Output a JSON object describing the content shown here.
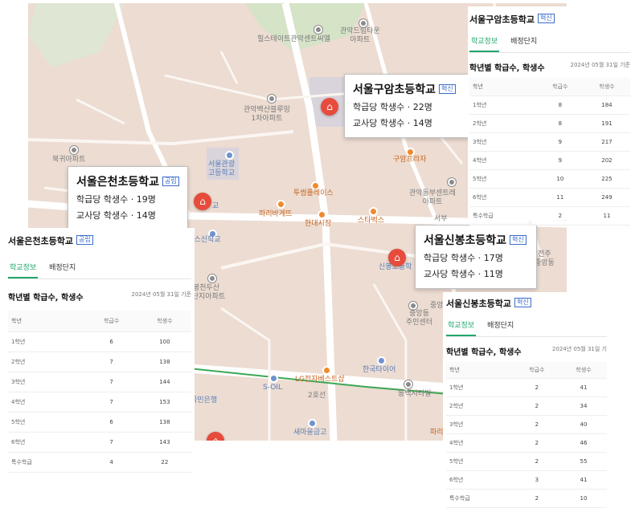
{
  "map": {
    "pois": [
      {
        "id": "hillstate",
        "label": "힐스테이트관악센트씨엘",
        "style": "gray"
      },
      {
        "id": "dreamtown",
        "label": "관악드림타운\n아파트",
        "style": "gray"
      },
      {
        "id": "byeoksan",
        "label": "관악벽산블루밍\n1차아파트",
        "style": "gray"
      },
      {
        "id": "bukgeo",
        "label": "북귀아파트",
        "style": "gray"
      },
      {
        "id": "gwanak_high",
        "label": "서울관광\n고등학교",
        "style": "blue"
      },
      {
        "id": "touples",
        "label": "투썸플레이스",
        "style": "orange"
      },
      {
        "id": "paris",
        "label": "파리바게뜨",
        "style": "orange"
      },
      {
        "id": "hyundai",
        "label": "현대시장",
        "style": "orange"
      },
      {
        "id": "starbucks",
        "label": "스타벅스",
        "style": "orange"
      },
      {
        "id": "guam_plaza",
        "label": "구암프라자",
        "style": "orange"
      },
      {
        "id": "gwanak_central",
        "label": "관악동부센트레\n아파트",
        "style": "gray"
      },
      {
        "id": "balsan",
        "label": "발산스신학교",
        "style": "blue"
      },
      {
        "id": "bongcheon",
        "label": "봉천두산\n1단지아파트",
        "style": "gray"
      },
      {
        "id": "jungang",
        "label": "중앙동\n주민센터",
        "style": "gray"
      },
      {
        "id": "jeonju",
        "label": "전주\n중앙동",
        "style": "gray"
      },
      {
        "id": "hankook",
        "label": "한국타이어",
        "style": "blue"
      },
      {
        "id": "dongbaek",
        "label": "동백시티빌",
        "style": "gray"
      },
      {
        "id": "lg",
        "label": "LG전자베스트샵",
        "style": "orange"
      },
      {
        "id": "soil",
        "label": "S-OIL",
        "style": "blue"
      },
      {
        "id": "kookmin",
        "label": "국민은행",
        "style": "blue"
      },
      {
        "id": "saemaeul",
        "label": "새마을금고",
        "style": "blue"
      },
      {
        "id": "line2",
        "label": "2호선",
        "style": "gray"
      },
      {
        "id": "shinbong_map",
        "label": "신봉초등학",
        "style": "blue"
      },
      {
        "id": "eunchun_map",
        "label": "교",
        "style": "blue"
      },
      {
        "id": "parisb",
        "label": "파리",
        "style": "orange"
      },
      {
        "id": "jungang_b",
        "label": "중앙",
        "style": "gray"
      },
      {
        "id": "seobuk",
        "label": "서부",
        "style": "gray"
      }
    ],
    "bubbles": {
      "guam": {
        "name": "서울구암초등학교",
        "badge": "혁신",
        "line1": "학급당 학생수 · 22명",
        "line2": "교사당 학생수 · 14명"
      },
      "eunchun": {
        "name": "서울은천초등학교",
        "badge": "공립",
        "line1": "학급당 학생수 · 19명",
        "line2": "교사당 학생수 · 14명"
      },
      "shinbong": {
        "name": "서울신봉초등학교",
        "badge": "혁신",
        "line1": "학급당 학생수 · 17명",
        "line2": "교사당 학생수 · 11명"
      }
    }
  },
  "panels": {
    "guam": {
      "name": "서울구암초등학교",
      "badge": "혁신",
      "tabs": [
        "학교정보",
        "배정단지"
      ],
      "section": "학년별 학급수, 학생수",
      "date": "2024년 05월 31일 기준",
      "headers": [
        "학년",
        "학급수",
        "학생수"
      ],
      "rows": [
        [
          "1학년",
          "8",
          "184"
        ],
        [
          "2학년",
          "8",
          "191"
        ],
        [
          "3학년",
          "9",
          "217"
        ],
        [
          "4학년",
          "9",
          "202"
        ],
        [
          "5학년",
          "10",
          "225"
        ],
        [
          "6학년",
          "11",
          "249"
        ],
        [
          "특수학급",
          "2",
          "11"
        ]
      ]
    },
    "eunchun": {
      "name": "서울은천초등학교",
      "badge": "공립",
      "tabs": [
        "학교정보",
        "배정단지"
      ],
      "section": "학년별 학급수, 학생수",
      "date": "2024년 05월 31일 기준",
      "headers": [
        "학년",
        "학급수",
        "학생수"
      ],
      "rows": [
        [
          "1학년",
          "6",
          "100"
        ],
        [
          "2학년",
          "7",
          "138"
        ],
        [
          "3학년",
          "7",
          "144"
        ],
        [
          "4학년",
          "7",
          "153"
        ],
        [
          "5학년",
          "6",
          "138"
        ],
        [
          "6학년",
          "7",
          "143"
        ],
        [
          "특수학급",
          "4",
          "22"
        ]
      ]
    },
    "shinbong": {
      "name": "서울신봉초등학교",
      "badge": "혁신",
      "tabs": [
        "학교정보",
        "배정단지"
      ],
      "section": "학년별 학급수, 학생수",
      "date": "2024년 05월 31일 기",
      "headers": [
        "학년",
        "학급수",
        "학생수"
      ],
      "rows": [
        [
          "1학년",
          "2",
          "41"
        ],
        [
          "2학년",
          "2",
          "34"
        ],
        [
          "3학년",
          "2",
          "40"
        ],
        [
          "4학년",
          "2",
          "46"
        ],
        [
          "5학년",
          "2",
          "55"
        ],
        [
          "6학년",
          "3",
          "41"
        ],
        [
          "특수학급",
          "2",
          "10"
        ]
      ]
    }
  }
}
